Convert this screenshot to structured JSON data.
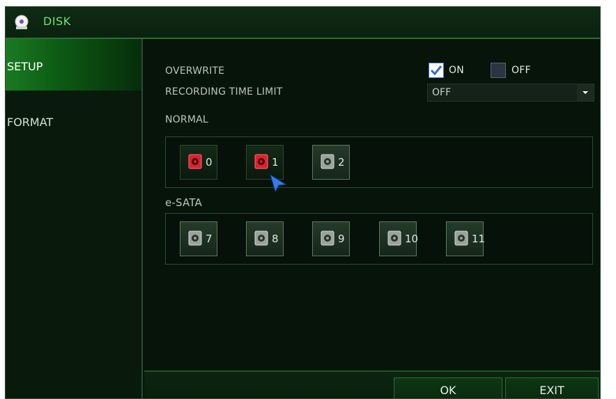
{
  "window": {
    "title": "DISK",
    "icon": "disk-icon"
  },
  "sidebar": {
    "items": [
      {
        "label": "SETUP",
        "selected": true
      },
      {
        "label": "FORMAT",
        "selected": false
      }
    ]
  },
  "settings": {
    "overwrite": {
      "label": "OVERWRITE",
      "on_label": "ON",
      "off_label": "OFF",
      "on_checked": true,
      "off_checked": false
    },
    "recording_time_limit": {
      "label": "RECORDING TIME LIMIT",
      "value": "OFF"
    }
  },
  "groups": {
    "normal": {
      "label": "NORMAL",
      "disks": [
        {
          "number": "0",
          "status": "red"
        },
        {
          "number": "1",
          "status": "red"
        },
        {
          "number": "2",
          "status": "gray"
        }
      ]
    },
    "esata": {
      "label": "e-SATA",
      "disks": [
        {
          "number": "7",
          "status": "gray"
        },
        {
          "number": "8",
          "status": "gray"
        },
        {
          "number": "9",
          "status": "gray"
        },
        {
          "number": "10",
          "status": "gray"
        },
        {
          "number": "11",
          "status": "gray"
        }
      ]
    }
  },
  "buttons": {
    "ok": "OK",
    "exit": "EXIT"
  },
  "colors": {
    "accent_green": "#6ee66e",
    "selected_tab": "#1a7a21",
    "disk_red": "#e0202e",
    "disk_gray": "#9aa39a",
    "checkbox_checked": "#3f7bd6"
  }
}
